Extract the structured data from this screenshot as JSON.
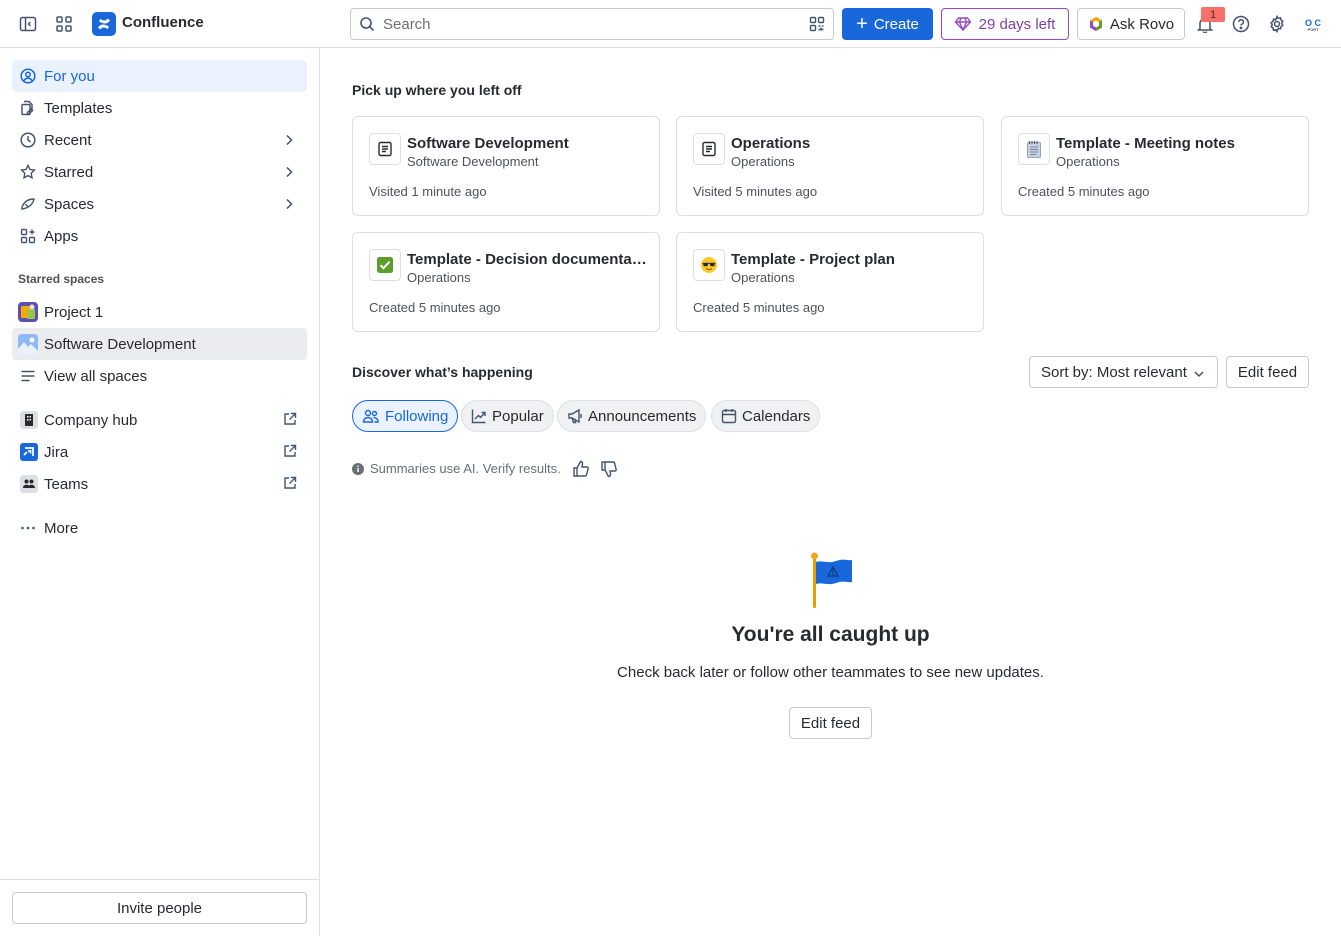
{
  "topbar": {
    "app_name": "Confluence",
    "search_placeholder": "Search",
    "create_label": "Create",
    "trial_label": "29 days left",
    "rovo_label": "Ask Rovo",
    "notification_count": "1",
    "avatar_initials_top": "O C",
    "avatar_initials_bottom": "PORT",
    "colors": {
      "brand": "#1868db",
      "trial": "#803fa5"
    }
  },
  "sidebar": {
    "nav": [
      {
        "label": "For you",
        "icon": "person-circle-icon"
      },
      {
        "label": "Templates",
        "icon": "template-icon"
      },
      {
        "label": "Recent",
        "icon": "clock-icon"
      },
      {
        "label": "Starred",
        "icon": "star-icon"
      },
      {
        "label": "Spaces",
        "icon": "spaces-icon"
      },
      {
        "label": "Apps",
        "icon": "apps-icon"
      }
    ],
    "starred_spaces_label": "Starred spaces",
    "spaces": [
      {
        "label": "Project 1"
      },
      {
        "label": "Software Development"
      },
      {
        "label": "View all spaces"
      }
    ],
    "links": [
      {
        "label": "Company hub"
      },
      {
        "label": "Jira"
      },
      {
        "label": "Teams"
      }
    ],
    "more_label": "More",
    "invite_label": "Invite people"
  },
  "main": {
    "recent_heading": "Pick up where you left off",
    "cards": [
      {
        "title": "Software Development",
        "space": "Software Development",
        "meta": "Visited 1 minute ago",
        "icon": "page-icon"
      },
      {
        "title": "Operations",
        "space": "Operations",
        "meta": "Visited 5 minutes ago",
        "icon": "page-icon"
      },
      {
        "title": "Template - Meeting notes",
        "space": "Operations",
        "meta": "Created 5 minutes ago",
        "icon": "notepad-icon"
      },
      {
        "title": "Template - Decision documentation",
        "space": "Operations",
        "meta": "Created 5 minutes ago",
        "icon": "checkmark-icon"
      },
      {
        "title": "Template - Project plan",
        "space": "Operations",
        "meta": "Created 5 minutes ago",
        "icon": "sunglasses-icon"
      }
    ],
    "discover_heading": "Discover what’s happening",
    "sort_label": "Sort by: Most relevant",
    "edit_feed_label": "Edit feed",
    "filters": [
      {
        "label": "Following",
        "icon": "people-icon",
        "selected": true
      },
      {
        "label": "Popular",
        "icon": "trending-icon",
        "selected": false
      },
      {
        "label": "Announcements",
        "icon": "megaphone-icon",
        "selected": false
      },
      {
        "label": "Calendars",
        "icon": "calendar-icon",
        "selected": false
      }
    ],
    "ai_note": "Summaries use AI. Verify results.",
    "empty_title": "You're all caught up",
    "empty_desc": "Check back later or follow other teammates to see new updates.",
    "empty_button": "Edit feed"
  }
}
